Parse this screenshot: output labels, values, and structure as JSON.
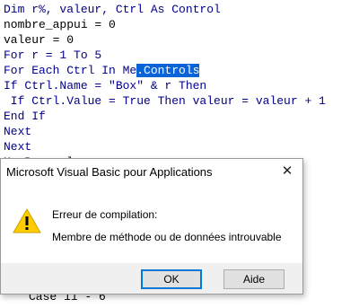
{
  "code": {
    "lines": [
      [
        {
          "t": "Dim r%, valeur, Ctrl As Control",
          "k": "kw"
        }
      ],
      [
        {
          "t": "nombre_appui = 0",
          "k": ""
        }
      ],
      [
        {
          "t": "valeur = 0",
          "k": ""
        }
      ],
      [
        {
          "t": "For r = 1 To 5",
          "k": "kw"
        }
      ],
      [
        {
          "t": "For Each Ctrl In Me",
          "k": "kw"
        },
        {
          "t": ".Controls",
          "k": "sel"
        }
      ],
      [
        {
          "t": "If Ctrl.Name = \"Box\" & r Then",
          "k": "kw"
        }
      ],
      [
        {
          "t": " If Ctrl.Value = True Then valeur = valeur + 1",
          "k": "kw"
        }
      ],
      [
        {
          "t": "End If",
          "k": "kw"
        }
      ],
      [
        {
          "t": "Next",
          "k": "kw"
        }
      ],
      [
        {
          "t": "Next",
          "k": "kw"
        }
      ],
      [
        {
          "t": "MsgBox valeur",
          "k": ""
        }
      ],
      [
        {
          "t": "Case 11 - 6",
          "k": ""
        }
      ]
    ]
  },
  "dialog": {
    "title": "Microsoft Visual Basic pour Applications",
    "close_glyph": "✕",
    "message_title": "Erreur de compilation:",
    "message_body": "Membre de méthode ou de données introuvable",
    "ok_label": "OK",
    "help_label": "Aide"
  },
  "colors": {
    "keyword": "#00008b",
    "selection": "#0a64d8",
    "warning_fill": "#ffcc00",
    "focus_border": "#0078d7"
  }
}
